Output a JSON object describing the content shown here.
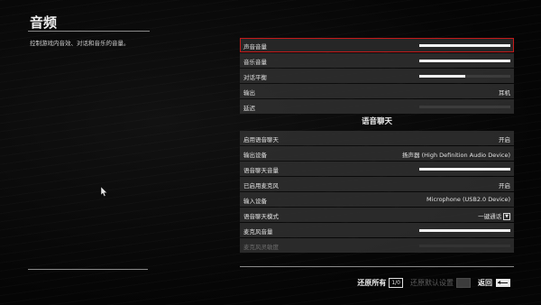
{
  "page": {
    "title": "音频",
    "description": "控制游戏内音效、对话和音乐的音量。"
  },
  "settings": {
    "rows": [
      {
        "label": "声音音量",
        "type": "slider",
        "value": 1.0,
        "selected": true
      },
      {
        "label": "音乐音量",
        "type": "slider",
        "value": 1.0
      },
      {
        "label": "对话平衡",
        "type": "slider",
        "value": 0.5
      },
      {
        "label": "输出",
        "type": "value",
        "value": "耳机"
      },
      {
        "label": "延迟",
        "type": "slider",
        "value": 0.0
      }
    ],
    "voice_chat_heading": "语音聊天",
    "voice_rows": [
      {
        "label": "启用语音聊天",
        "type": "value",
        "value": "开启"
      },
      {
        "label": "输出设备",
        "type": "value",
        "value": "扬声器 (High Definition Audio Device)"
      },
      {
        "label": "语音聊天音量",
        "type": "slider",
        "value": 1.0
      },
      {
        "label": "已启用麦克风",
        "type": "value",
        "value": "开启"
      },
      {
        "label": "输入设备",
        "type": "value",
        "value": "Microphone (USB2.0 Device)"
      },
      {
        "label": "语音聊天模式",
        "type": "value",
        "value": "一键通话",
        "key": "▼"
      },
      {
        "label": "麦克风音量",
        "type": "slider",
        "value": 1.0
      },
      {
        "label": "麦克风灵敏度",
        "type": "slider",
        "value": 0.0,
        "disabled": true
      }
    ]
  },
  "footer": {
    "reset_all_label": "还原所有",
    "reset_all_key": "1/0",
    "reset_default_label": "还原默认设置",
    "back_label": "返回"
  },
  "colors": {
    "selection_border": "#c41a1a",
    "slider_fill": "#f2f2f2"
  }
}
